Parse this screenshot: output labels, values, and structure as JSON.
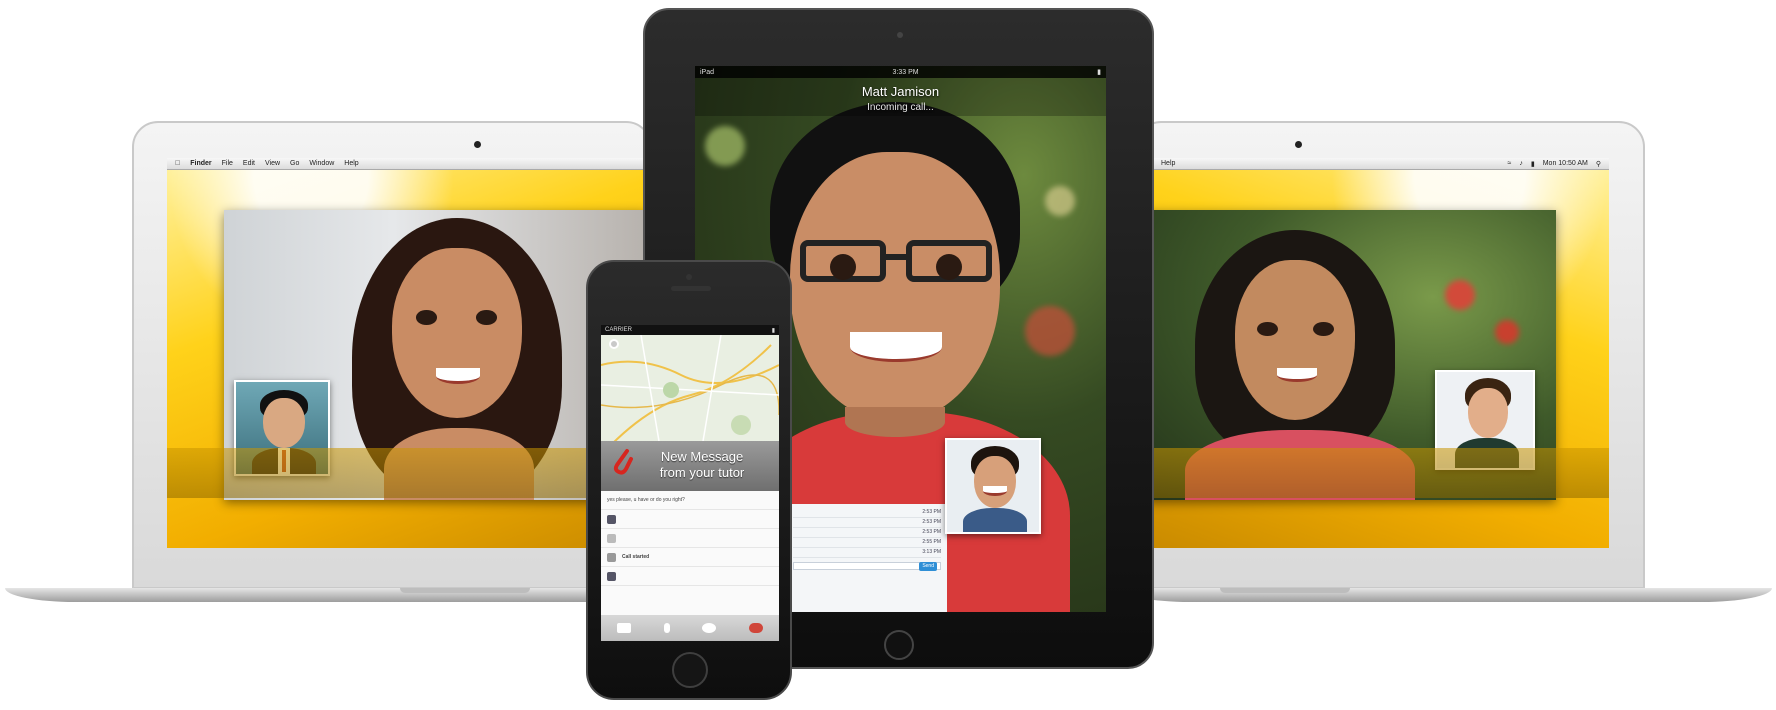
{
  "left_laptop": {
    "menubar": {
      "apple": "",
      "app": "Finder",
      "menus": [
        "File",
        "Edit",
        "View",
        "Go",
        "Window",
        "Help"
      ]
    }
  },
  "right_laptop": {
    "menubar": {
      "menus": [
        "Help"
      ],
      "clock": "Mon 10:50 AM"
    }
  },
  "ipad": {
    "status_left": "iPad",
    "status_time": "3:33 PM",
    "caller_name": "Matt Jamison",
    "call_status": "Incoming call...",
    "chat_rows": [
      [
        "",
        "2:53 PM"
      ],
      [
        "",
        "2:53 PM"
      ],
      [
        "",
        "2:53 PM"
      ],
      [
        "",
        "2:55 PM"
      ],
      [
        "",
        "3:13 PM"
      ]
    ],
    "chat_send_label": "Send"
  },
  "iphone": {
    "carrier": "CARRIER",
    "notification_line1": "New Message",
    "notification_line2": "from your tutor",
    "messages": [
      "yes please, u have or do you right?",
      "",
      "",
      "Call started",
      ""
    ]
  },
  "colors": {
    "wallpaper_yellow": "#ffd21a",
    "call_red_shirt": "#d83a3a"
  }
}
